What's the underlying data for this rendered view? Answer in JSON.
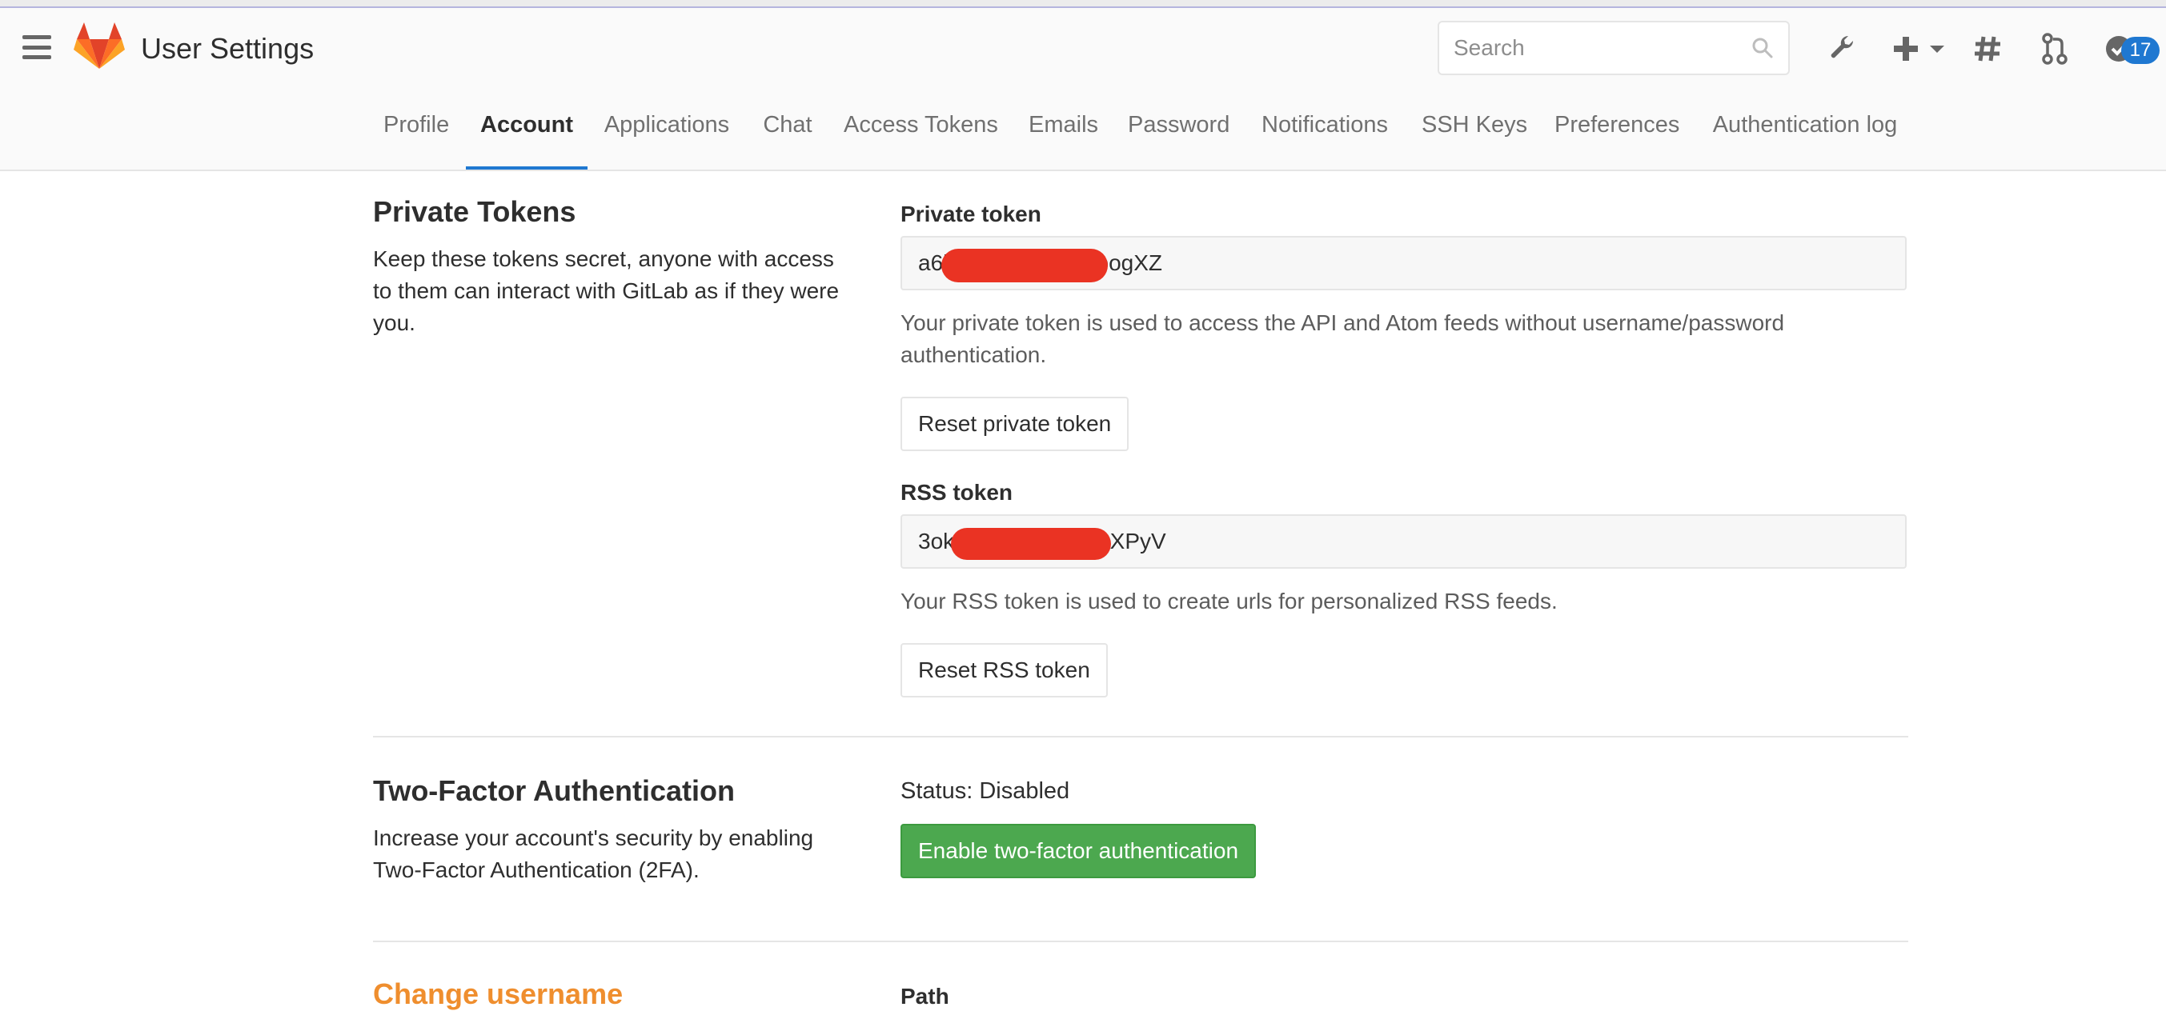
{
  "header": {
    "title": "User Settings",
    "search_placeholder": "Search",
    "icons": [
      "menu-icon",
      "gitlab-logo",
      "search-icon",
      "wrench-icon",
      "plus-icon",
      "chevron-down-icon",
      "hash-icon",
      "merge-request-icon",
      "todo-check-icon"
    ],
    "todo_count": "17",
    "brand_color": "#e24329"
  },
  "nav": {
    "tabs": [
      {
        "label": "Profile"
      },
      {
        "label": "Account"
      },
      {
        "label": "Applications"
      },
      {
        "label": "Chat"
      },
      {
        "label": "Access Tokens"
      },
      {
        "label": "Emails"
      },
      {
        "label": "Password"
      },
      {
        "label": "Notifications"
      },
      {
        "label": "SSH Keys"
      },
      {
        "label": "Preferences"
      },
      {
        "label": "Authentication log"
      }
    ],
    "active": "Account",
    "accent_color": "#1f78d1"
  },
  "private_tokens": {
    "title": "Private Tokens",
    "description": "Keep these tokens secret, anyone with access to them can interact with GitLab as if they were you.",
    "private_token": {
      "label": "Private token",
      "value": "a6b                   jQpogXZ",
      "help": "Your private token is used to access the API and Atom feeds without username/password authentication.",
      "reset_label": "Reset private token"
    },
    "rss_token": {
      "label": "RSS token",
      "value": "3ok                     9eXPyV",
      "help": "Your RSS token is used to create urls for personalized RSS feeds.",
      "reset_label": "Reset RSS token"
    },
    "redaction_color": "#ea3323"
  },
  "two_factor": {
    "title": "Two-Factor Authentication",
    "description": "Increase your account's security by enabling Two-Factor Authentication (2FA).",
    "status": "Status: Disabled",
    "enable_label": "Enable two-factor authentication",
    "button_color": "#4ca84f"
  },
  "change_username": {
    "title": "Change username",
    "path_label": "Path",
    "title_color": "#ef8e2e"
  }
}
